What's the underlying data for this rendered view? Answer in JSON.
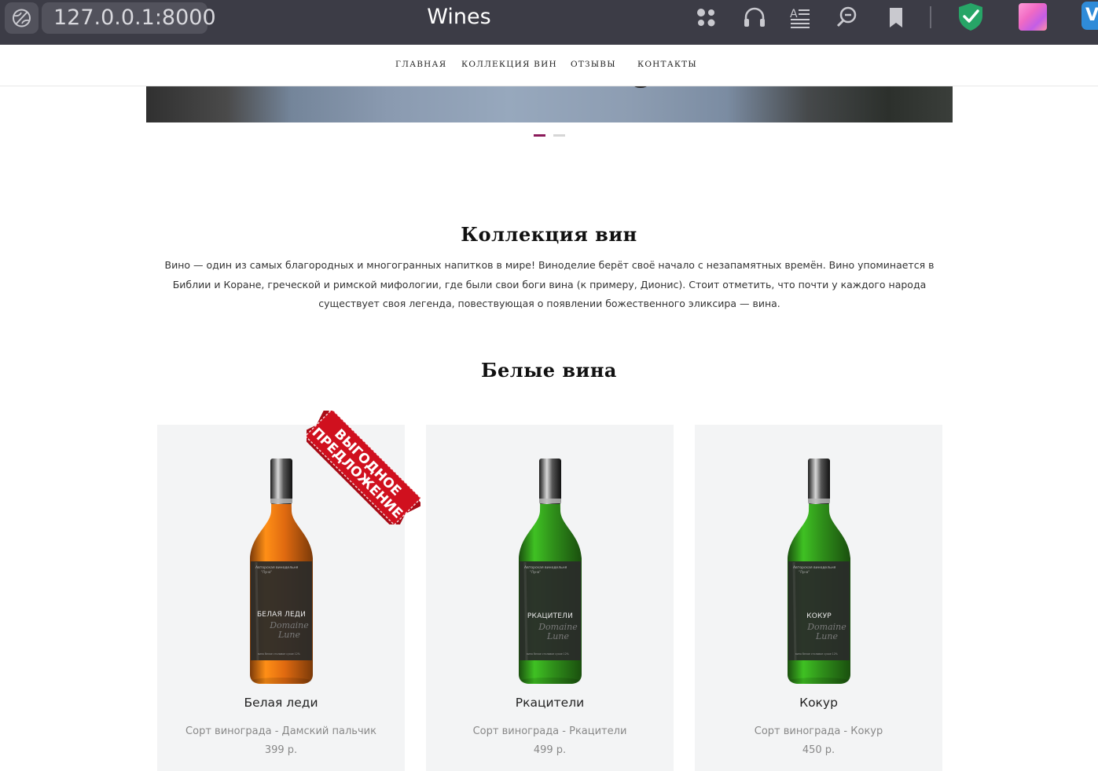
{
  "browser": {
    "url": "127.0.0.1:8000",
    "tab_title": "Wines",
    "vk_letter": "V",
    "toolbar_icons": [
      "apps-icon",
      "headphones-icon",
      "reader-icon",
      "zoom-icon",
      "bookmark-icon",
      "shield-check-icon",
      "extension-icon"
    ]
  },
  "nav": {
    "items": [
      "ГЛАВНАЯ",
      "КОЛЛЕКЦИЯ ВИН",
      "ОТЗЫВЫ",
      "КОНТАКТЫ"
    ]
  },
  "slider": {
    "slide_count": 2,
    "active_index": 0,
    "active_color": "#8b1a5a",
    "inactive_color": "#d6d6d6"
  },
  "collection": {
    "title": "Коллекция вин",
    "intro": "Вино — один из самых благородных и многогранных напитков в мире! Виноделие берёт своё начало с незапамятных времён. Вино упоминается в Библии и Коране, греческой и римской мифологии, где были свои боги вина (к примеру, Дионис). Стоит отметить, что почти у каждого народа существует своя легенда, повествующая о появлении божественного эликсира — вина."
  },
  "white_wines": {
    "title": "Белые вина",
    "promo_ribbon": {
      "line1": "ВЫГОДНОЕ",
      "line2": "ПРЕДЛОЖЕНИЕ",
      "color": "#d0101e"
    },
    "products": [
      {
        "name": "Белая леди",
        "bottle_label": "БЕЛАЯ ЛЕДИ",
        "variety": "Сорт винограда - Дамский пальчик",
        "price": "399 р.",
        "liquid_color": "#e06a10"
      },
      {
        "name": "Ркацители",
        "bottle_label": "РКАЦИТЕЛИ",
        "variety": "Сорт винограда - Ркацители",
        "price": "499 р.",
        "liquid_color": "#2f8f1a"
      },
      {
        "name": "Кокур",
        "bottle_label": "КОКУР",
        "variety": "Сорт винограда - Кокур",
        "price": "450 р.",
        "liquid_color": "#2f8f1a"
      }
    ]
  }
}
